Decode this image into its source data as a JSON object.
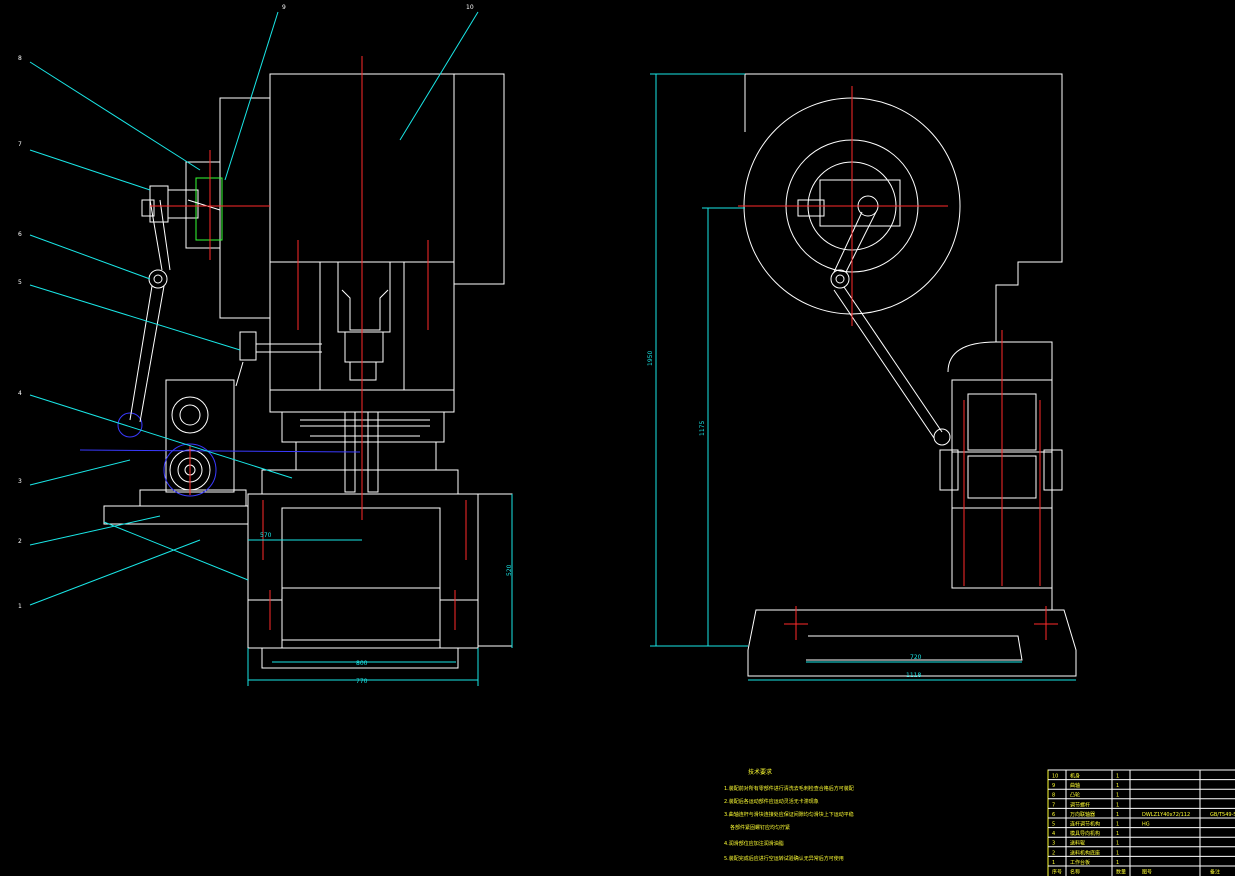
{
  "drawing": {
    "background": "#000000",
    "colors": {
      "outline": "#ffffff",
      "centerline": "#ff2a2a",
      "dimension": "#19e6e6",
      "hidden": "#3a3aff",
      "note": "#ffff33",
      "detail": "#33ff33"
    }
  },
  "callouts": [
    "1",
    "2",
    "3",
    "4",
    "5",
    "6",
    "7",
    "8",
    "9",
    "10"
  ],
  "dimensions": {
    "side_view": {
      "d570": "570",
      "d800": "800",
      "d770": "770",
      "d520": "520"
    },
    "front_view": {
      "d1950": "1950",
      "d1175": "1175",
      "d720": "720",
      "d1118": "1118"
    }
  },
  "notes": {
    "title": "技术要求",
    "lines": [
      "1.装配前对所有零部件进行清洗去毛刺检查合格后方可装配",
      "2.装配后各运动部件应运动灵活无卡滞现象",
      "3.曲轴连杆与滑块连接处应保证间隙均匀滑块上下运动平稳",
      "各部件紧固螺钉应均匀拧紧",
      "4.润滑部位应加注润滑油脂",
      "5.装配完成后应进行空运转试验确认无异常后方可使用"
    ]
  },
  "bom": {
    "rows": [
      {
        "no": "10",
        "name": "机身",
        "qty": "1",
        "code": "",
        "remark": ""
      },
      {
        "no": "9",
        "name": "曲轴",
        "qty": "1",
        "code": "",
        "remark": ""
      },
      {
        "no": "8",
        "name": "凸轮",
        "qty": "1",
        "code": "",
        "remark": ""
      },
      {
        "no": "7",
        "name": "调节螺杆",
        "qty": "1",
        "code": "",
        "remark": ""
      },
      {
        "no": "6",
        "name": "万向联轴器",
        "qty": "1",
        "code": "DWLZ1Y40x72/112",
        "remark": "GB/T549-S"
      },
      {
        "no": "5",
        "name": "连杆调节机构",
        "qty": "1",
        "code": "HG",
        "remark": ""
      },
      {
        "no": "4",
        "name": "模具导向机构",
        "qty": "1",
        "code": "",
        "remark": ""
      },
      {
        "no": "3",
        "name": "送料辊",
        "qty": "1",
        "code": "",
        "remark": ""
      },
      {
        "no": "2",
        "name": "送料机构底座",
        "qty": "1",
        "code": "",
        "remark": ""
      },
      {
        "no": "1",
        "name": "工作台板",
        "qty": "1",
        "code": "",
        "remark": ""
      }
    ],
    "header": {
      "no": "序号",
      "name": "名称",
      "qty": "数量",
      "code": "图号",
      "remark": "备注"
    }
  }
}
